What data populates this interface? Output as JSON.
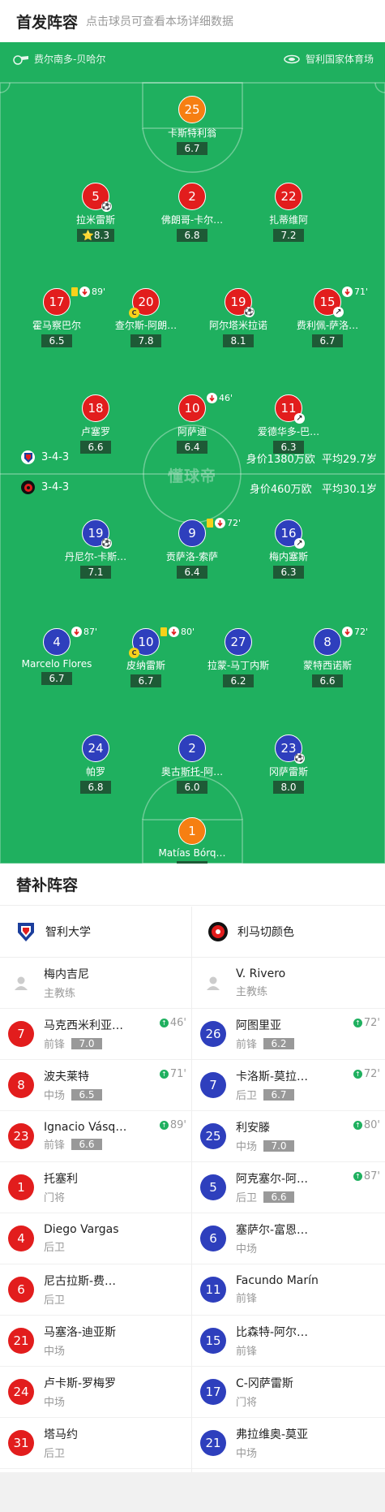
{
  "header": {
    "title": "首发阵容",
    "subtitle": "点击球员可查看本场详细数据"
  },
  "pitch": {
    "coach_home": "费尔南多-贝哈尔",
    "stadium": "智利国家体育场",
    "watermark": "懂球帝"
  },
  "home_stats": {
    "formation": "3-4-3",
    "value": "身价1380万欧",
    "age": "平均29.7岁"
  },
  "away_stats": {
    "formation": "3-4-3",
    "value": "身价460万欧",
    "age": "平均30.1岁"
  },
  "top_players": [
    {
      "num": "25",
      "name": "卡斯特利翁",
      "rating": "6.7",
      "color": "orange"
    },
    {
      "num": "5",
      "name": "拉米雷斯",
      "rating": "8.3",
      "color": "red",
      "star": "⭐",
      "ball": true
    },
    {
      "num": "2",
      "name": "佛朗哥-卡尔…",
      "rating": "6.8",
      "color": "red"
    },
    {
      "num": "22",
      "name": "扎蒂维阿",
      "rating": "7.2",
      "color": "red"
    },
    {
      "num": "17",
      "name": "霍马察巴尔",
      "rating": "6.5",
      "color": "red",
      "ev": "89'",
      "yc": true,
      "subout": true
    },
    {
      "num": "20",
      "name": "查尔斯-阿朗…",
      "rating": "7.8",
      "color": "red",
      "capt": true
    },
    {
      "num": "19",
      "name": "阿尔塔米拉诺",
      "rating": "8.1",
      "color": "red",
      "ball": true
    },
    {
      "num": "15",
      "name": "费利佩-萨洛…",
      "rating": "6.7",
      "color": "red",
      "ev": "71'",
      "subout": true,
      "boot": true
    },
    {
      "num": "18",
      "name": "卢塞罗",
      "rating": "6.6",
      "color": "red"
    },
    {
      "num": "10",
      "name": "阿萨迪",
      "rating": "6.4",
      "color": "red",
      "ev": "46'",
      "subout": true
    },
    {
      "num": "11",
      "name": "爱德华多-巴…",
      "rating": "6.3",
      "color": "red",
      "boot": true
    }
  ],
  "bottom_players": [
    {
      "num": "19",
      "name": "丹尼尔-卡斯…",
      "rating": "7.1",
      "color": "blue",
      "ball": true
    },
    {
      "num": "9",
      "name": "贡萨洛-索萨",
      "rating": "6.4",
      "color": "blue",
      "ev": "72'",
      "yc": true,
      "subout": true
    },
    {
      "num": "16",
      "name": "梅内塞斯",
      "rating": "6.3",
      "color": "blue",
      "boot": true
    },
    {
      "num": "4",
      "name": "Marcelo Flores",
      "rating": "6.7",
      "color": "blue",
      "ev": "87'",
      "subout": true
    },
    {
      "num": "10",
      "name": "皮纳雷斯",
      "rating": "6.7",
      "color": "blue",
      "ev": "80'",
      "yc": true,
      "subout": true,
      "capt": true
    },
    {
      "num": "27",
      "name": "拉蒙-马丁内斯",
      "rating": "6.2",
      "color": "blue"
    },
    {
      "num": "8",
      "name": "蒙特西诺斯",
      "rating": "6.6",
      "color": "blue",
      "ev": "72'",
      "subout": true
    },
    {
      "num": "24",
      "name": "帕罗",
      "rating": "6.8",
      "color": "blue"
    },
    {
      "num": "2",
      "name": "奥古斯托-阿…",
      "rating": "6.0",
      "color": "blue"
    },
    {
      "num": "23",
      "name": "冈萨雷斯",
      "rating": "8.0",
      "color": "blue",
      "ball": true
    },
    {
      "num": "1",
      "name": "Matías Bórq…",
      "rating": "6.8",
      "color": "orange"
    }
  ],
  "subs": {
    "title": "替补阵容",
    "home": {
      "team": "智利大学",
      "coach": {
        "name": "梅内吉尼",
        "role": "主教练"
      },
      "players": [
        {
          "num": "7",
          "name": "马克西米利亚…",
          "pos": "前锋",
          "rating": "7.0",
          "min": "46'"
        },
        {
          "num": "8",
          "name": "波夫莱特",
          "pos": "中场",
          "rating": "6.5",
          "min": "71'"
        },
        {
          "num": "23",
          "name": "Ignacio Vásq…",
          "pos": "前锋",
          "rating": "6.6",
          "min": "89'"
        },
        {
          "num": "1",
          "name": "托塞利",
          "pos": "门将"
        },
        {
          "num": "4",
          "name": "Diego Vargas",
          "pos": "后卫"
        },
        {
          "num": "6",
          "name": "尼古拉斯-费…",
          "pos": "后卫"
        },
        {
          "num": "21",
          "name": "马塞洛-迪亚斯",
          "pos": "中场"
        },
        {
          "num": "24",
          "name": "卢卡斯-罗梅罗",
          "pos": "中场"
        },
        {
          "num": "31",
          "name": "塔马约",
          "pos": "后卫"
        }
      ]
    },
    "away": {
      "team": "利马切颜色",
      "coach": {
        "name": "V. Rivero",
        "role": "主教练"
      },
      "players": [
        {
          "num": "26",
          "name": "阿图里亚",
          "pos": "前锋",
          "rating": "6.2",
          "min": "72'"
        },
        {
          "num": "7",
          "name": "卡洛斯-莫拉…",
          "pos": "后卫",
          "rating": "6.7",
          "min": "72'"
        },
        {
          "num": "25",
          "name": "利安滕",
          "pos": "中场",
          "rating": "7.0",
          "min": "80'"
        },
        {
          "num": "5",
          "name": "阿克塞尔-阿…",
          "pos": "后卫",
          "rating": "6.6",
          "min": "87'"
        },
        {
          "num": "6",
          "name": "塞萨尔-富恩…",
          "pos": "中场"
        },
        {
          "num": "11",
          "name": "Facundo Marín",
          "pos": "前锋"
        },
        {
          "num": "15",
          "name": "比森特-阿尔…",
          "pos": "前锋"
        },
        {
          "num": "17",
          "name": "C-冈萨雷斯",
          "pos": "门将"
        },
        {
          "num": "21",
          "name": "弗拉维奥-莫亚",
          "pos": "中场"
        }
      ]
    }
  },
  "colors": {
    "pitch": "#1fb05f",
    "home": "#e21d1d",
    "away": "#2e3fbd",
    "gk": "#f67f12"
  }
}
